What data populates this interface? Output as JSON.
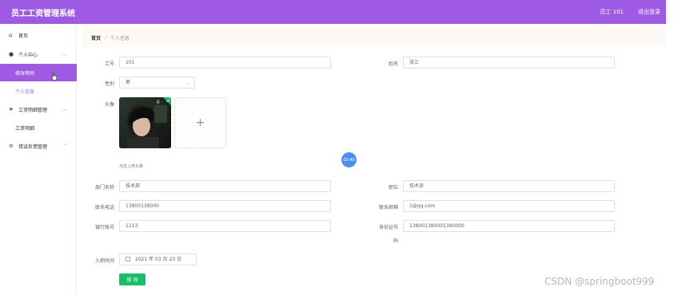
{
  "header": {
    "title": "员工工资管理系统",
    "user": "员工 101",
    "logout": "退出登录"
  },
  "sidebar": {
    "items": [
      {
        "label": "首页",
        "icon": "home-icon"
      },
      {
        "label": "个人中心",
        "icon": "user-icon"
      },
      {
        "label": "修改密码"
      },
      {
        "label": "个人信息"
      },
      {
        "label": "工资明细管理",
        "icon": "send-icon"
      },
      {
        "label": "工资明细"
      },
      {
        "label": "错误反馈管理",
        "icon": "menu-icon"
      }
    ]
  },
  "breadcrumb": {
    "home": "首页",
    "separator": "/",
    "current": "个人信息"
  },
  "form": {
    "id_label": "工号",
    "id_value": "101",
    "name_label": "姓名",
    "name_value": "张三",
    "gender_label": "性别",
    "gender_value": "男",
    "avatar_label": "头像",
    "upload_plus": "+",
    "upload_hint": "点击上传头像",
    "dept_label": "部门名称",
    "dept_value": "技术部",
    "position_label": "职位",
    "position_value": "技术员",
    "phone_label": "联系电话",
    "phone_value": "13800138000",
    "email_label": "联系邮箱",
    "email_value": "1@qq.com",
    "bank_label": "银行账号",
    "bank_value": "1213",
    "idcard_label_1": "身份证号",
    "idcard_label_2": "码",
    "idcard_value": "138001380001380000",
    "join_label": "入职时间",
    "join_value": "2021 年 03 月 23 日",
    "submit_label": "修 改"
  },
  "timer": "02:40",
  "watermark": "CSDN @springboot999",
  "colors": {
    "accent": "#9f5ae3",
    "button": "#19be6b",
    "timer": "#4b8ef0"
  }
}
